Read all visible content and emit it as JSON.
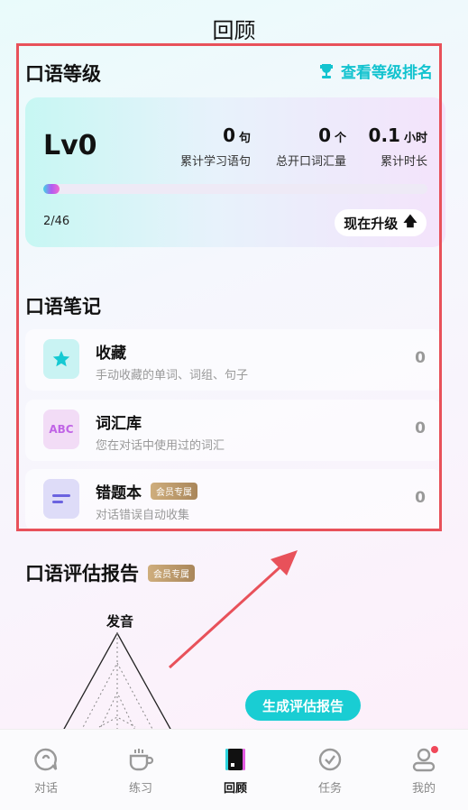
{
  "page": {
    "title": "回顾"
  },
  "level_section": {
    "title": "口语等级",
    "rank_link": "查看等级排名",
    "level": "Lv0",
    "progress_text": "2/46",
    "progress_fraction": 0.043,
    "upgrade_label": "现在升级",
    "stats": [
      {
        "value": "0",
        "unit": "句",
        "label": "累计学习语句"
      },
      {
        "value": "0",
        "unit": "个",
        "label": "总开口词汇量"
      },
      {
        "value": "0.1",
        "unit": "小时",
        "label": "累计时长"
      }
    ]
  },
  "notes_section": {
    "title": "口语笔记",
    "items": [
      {
        "title": "收藏",
        "subtitle": "手动收藏的单词、词组、句子",
        "count": "0",
        "icon": "star-icon"
      },
      {
        "title": "词汇库",
        "subtitle": "您在对话中使用过的词汇",
        "count": "0",
        "icon": "abc-icon",
        "icon_text": "ABC"
      },
      {
        "title": "错题本",
        "subtitle": "对话错误自动收集",
        "count": "0",
        "icon": "lines-icon",
        "badge": "会员专属"
      }
    ]
  },
  "report_section": {
    "title": "口语评估报告",
    "badge": "会员专属",
    "radar_label": "发音",
    "generate_label": "生成评估报告"
  },
  "nav": [
    {
      "label": "对话",
      "icon": "chat-icon"
    },
    {
      "label": "练习",
      "icon": "cup-icon"
    },
    {
      "label": "回顾",
      "icon": "review-icon",
      "active": true
    },
    {
      "label": "任务",
      "icon": "check-circle-icon"
    },
    {
      "label": "我的",
      "icon": "user-icon",
      "notification": true
    }
  ],
  "colors": {
    "accent": "#13c3cf",
    "highlight_border": "#e8515a",
    "annotation_arrow": "#e8515a"
  }
}
